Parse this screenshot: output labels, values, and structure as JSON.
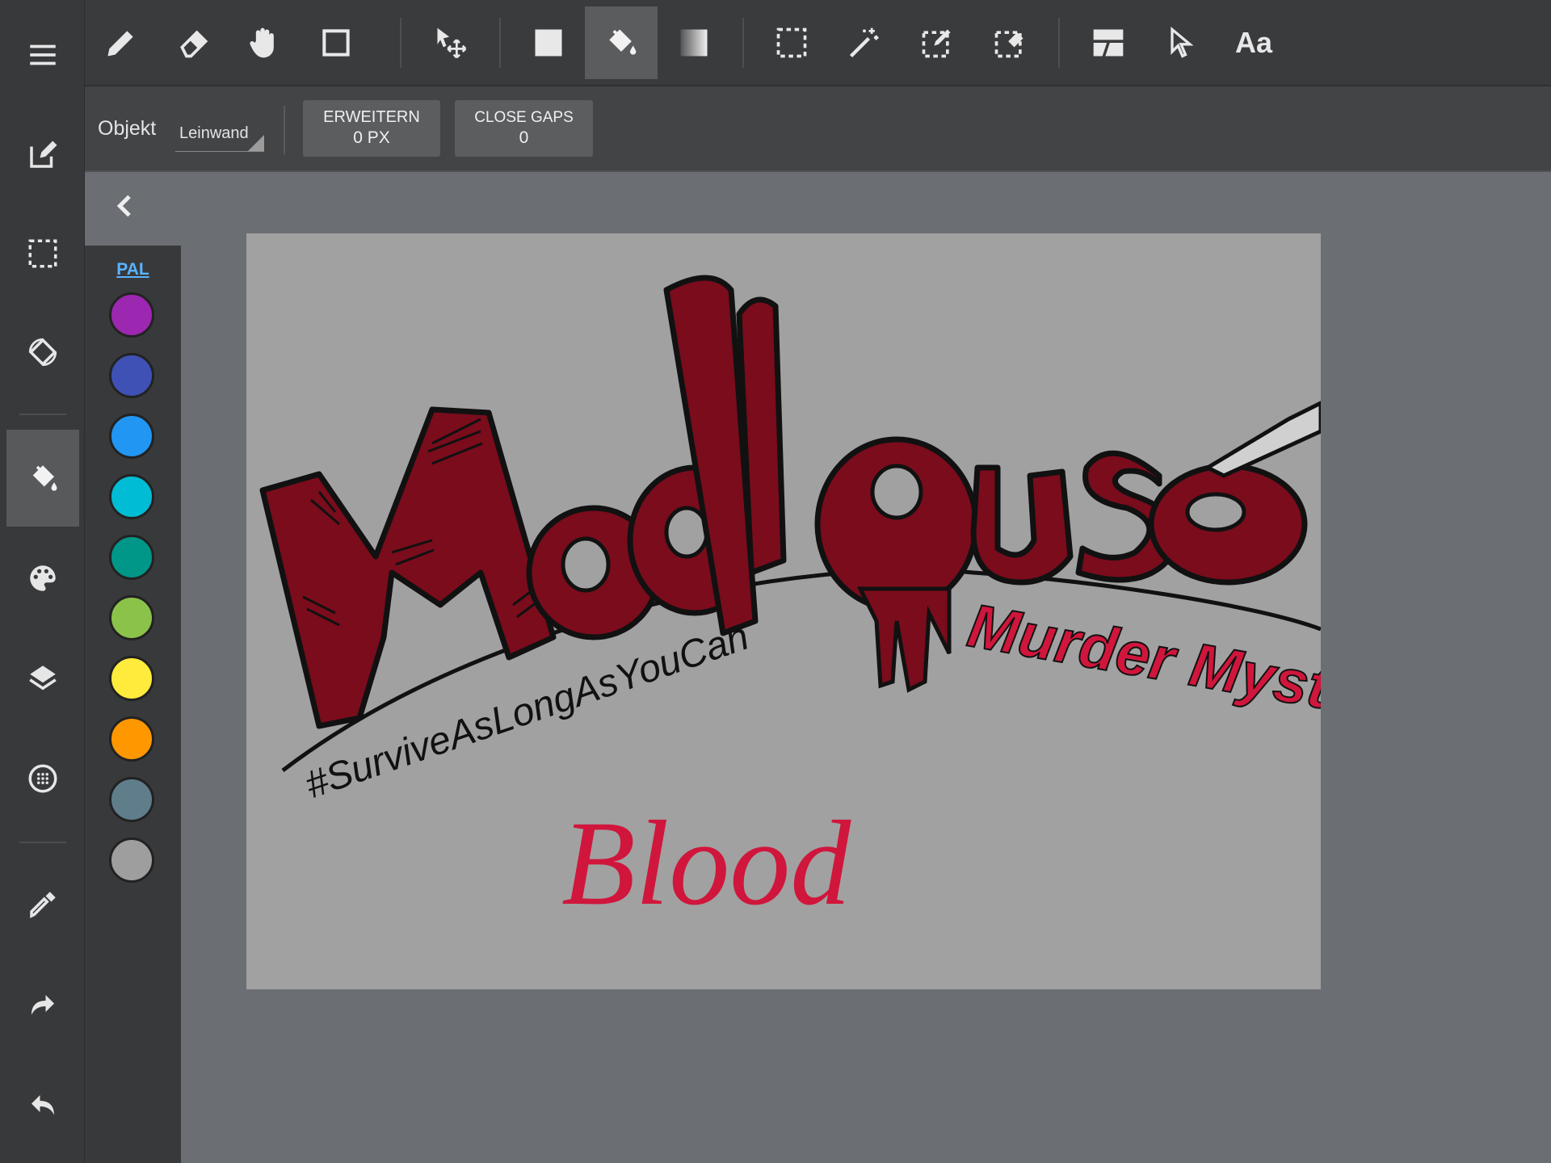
{
  "toolbar": {
    "tools": [
      "pencil-icon",
      "eraser-icon",
      "hand-icon",
      "rectangle-icon",
      "move-icon",
      "fill-shape-icon",
      "paint-bucket-icon",
      "gradient-icon",
      "marquee-icon",
      "magic-wand-icon",
      "selection-pen-icon",
      "selection-eraser-icon",
      "layout-icon",
      "pointer-icon",
      "text-icon"
    ],
    "text_tool_label": "Aa",
    "active_tool": "paint-bucket-icon"
  },
  "options": {
    "object_label": "Objekt",
    "object_value": "Leinwand",
    "expand_label": "ERWEITERN",
    "expand_value": "0 PX",
    "close_gaps_label": "CLOSE GAPS",
    "close_gaps_value": "0"
  },
  "sidebar": {
    "items": [
      "menu-icon",
      "edit-icon",
      "selection-icon",
      "rotate-icon",
      "paint-bucket-icon",
      "palette-icon",
      "layers-icon",
      "grid-icon",
      "eyedropper-icon",
      "redo-icon",
      "undo-icon"
    ],
    "active": "paint-bucket-icon"
  },
  "palette": {
    "title": "PAL",
    "colors": [
      "#9c27b0",
      "#3f51b5",
      "#2196f3",
      "#00bcd4",
      "#009688",
      "#8bc34a",
      "#ffeb3b",
      "#ff9800",
      "#607d8b",
      "#9e9e9e"
    ]
  },
  "drawing": {
    "title": "Madhouse",
    "subtitle": "Murder Mystery",
    "hashtag": "#SurviveAsLongAsYouCan",
    "handwriting": "Blood",
    "colors": {
      "logo_fill": "#7a0c1c",
      "subtitle": "#d0163c",
      "outline": "#111111",
      "background": "#a1a1a1"
    }
  }
}
